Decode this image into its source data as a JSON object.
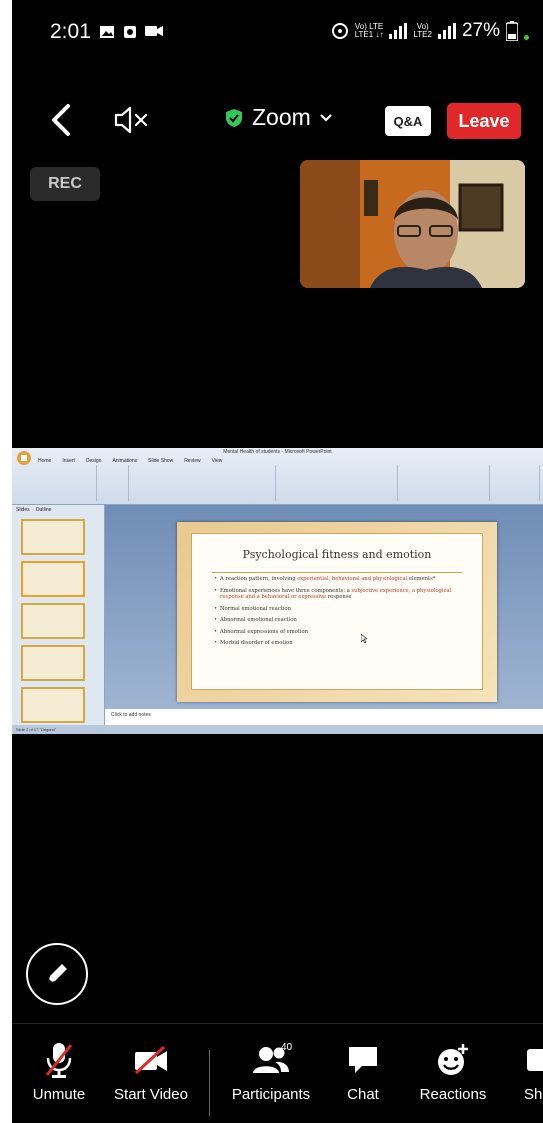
{
  "status_bar": {
    "time": "2:01",
    "network_1": "Vo) LTE\nLTE1 ↓↑",
    "network_2": "Vo)\nLTE2",
    "battery": "27%"
  },
  "top_bar": {
    "app_title": "Zoom",
    "qa_label": "Q&A",
    "leave_label": "Leave"
  },
  "recording": {
    "label": "REC"
  },
  "shared_screen": {
    "window_title": "Mental Health of students - Microsoft PowerPoint",
    "ribbon_tabs": [
      "Home",
      "Insert",
      "Design",
      "Animations",
      "Slide Show",
      "Review",
      "View"
    ],
    "pane_tabs": [
      "Slides",
      "Outline"
    ],
    "slide": {
      "title": "Psychological fitness and emotion",
      "bullets": [
        {
          "pre": "A reaction pattern, involving ",
          "red": "experiential, behavioral and physiological",
          "post": " elements*"
        },
        {
          "pre": "Emotional experiences have three components: a ",
          "red": "subjective experience, a physiological response and a behavioral or expressive",
          "post": " response"
        },
        {
          "pre": "Normal emotional reaction",
          "red": "",
          "post": ""
        },
        {
          "pre": "Abnormal emotional reaction",
          "red": "",
          "post": ""
        },
        {
          "pre": "Abnormal expressions of emotion",
          "red": "",
          "post": ""
        },
        {
          "pre": "Morbid disorder of emotion",
          "red": "",
          "post": ""
        }
      ]
    },
    "notes_placeholder": "Click to add notes",
    "status_text": "Slide 2 of 17   \"Origami\""
  },
  "toolbar": {
    "items": [
      {
        "label": "Unmute"
      },
      {
        "label": "Start Video"
      },
      {
        "label": "Participants",
        "count": "40"
      },
      {
        "label": "Chat"
      },
      {
        "label": "Reactions"
      },
      {
        "label": "Sh"
      }
    ]
  },
  "colors": {
    "leave": "#e02828",
    "shield": "#34c759",
    "background": "#000000"
  }
}
